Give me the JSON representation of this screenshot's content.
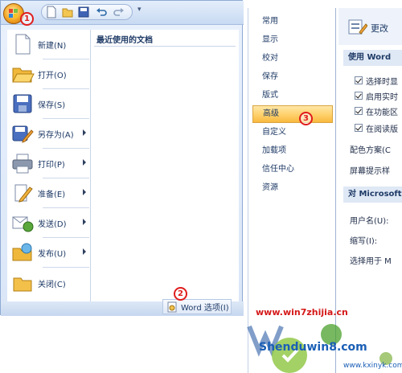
{
  "office_menu": {
    "recent_docs_title": "最近使用的文档",
    "items": [
      {
        "label": "新建(N)",
        "icon": "new-document-icon",
        "has_submenu": false
      },
      {
        "label": "打开(O)",
        "icon": "open-folder-icon",
        "has_submenu": false
      },
      {
        "label": "保存(S)",
        "icon": "save-disk-icon",
        "has_submenu": false
      },
      {
        "label": "另存为(A)",
        "icon": "save-as-icon",
        "has_submenu": true
      },
      {
        "label": "打印(P)",
        "icon": "printer-icon",
        "has_submenu": true
      },
      {
        "label": "准备(E)",
        "icon": "prepare-pencil-icon",
        "has_submenu": true
      },
      {
        "label": "发送(D)",
        "icon": "send-icon",
        "has_submenu": true
      },
      {
        "label": "发布(U)",
        "icon": "publish-icon",
        "has_submenu": true
      },
      {
        "label": "关闭(C)",
        "icon": "close-folder-icon",
        "has_submenu": false
      }
    ],
    "word_options_button": "Word 选项(I)"
  },
  "word_options": {
    "categories": [
      "常用",
      "显示",
      "校对",
      "保存",
      "版式",
      "高级",
      "自定义",
      "加载项",
      "信任中心",
      "资源"
    ],
    "active_category": "高级",
    "header_text": "更改",
    "section1_title": "使用 Word",
    "checkboxes": [
      {
        "label": "选择时显",
        "checked": true
      },
      {
        "label": "启用实时",
        "checked": true
      },
      {
        "label": "在功能区",
        "checked": true
      },
      {
        "label": "在阅读版",
        "checked": true
      }
    ],
    "color_scheme_label": "配色方案(C",
    "screen_tip_label": "屏幕提示样",
    "section2_title": "对 Microsoft",
    "username_label": "用户名(U):",
    "initials_label": "缩写(I):",
    "language_label": "选择用于 M"
  },
  "step_markers": [
    "1",
    "2",
    "3"
  ],
  "watermarks": {
    "line1": "www.win7zhijia.cn",
    "line2": "Shenduwin8.com",
    "line3": "www.kxinyk.com"
  }
}
